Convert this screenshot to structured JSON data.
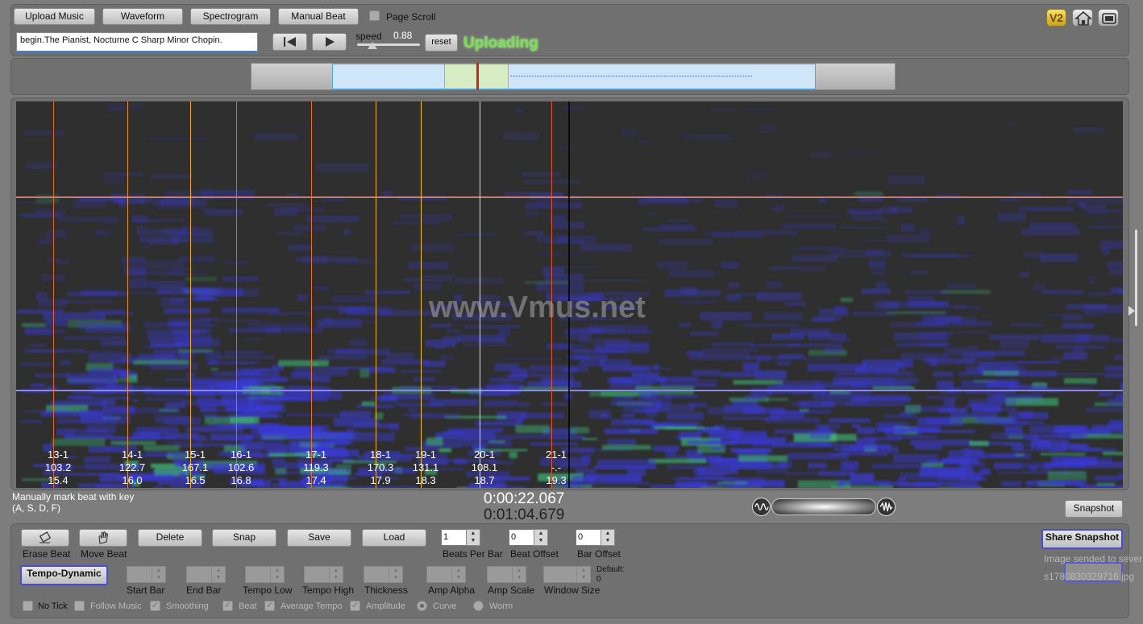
{
  "toolbar": {
    "upload_label": "Upload Music",
    "waveform_label": "Waveform",
    "spectrogram_label": "Spectrogram",
    "manual_beat_label": "Manual Beat",
    "page_scroll_label": "Page Scroll",
    "track_name": "begin.The Pianist, Nocturne C Sharp Minor Chopin.",
    "speed_label": "speed",
    "speed_value": "0.88",
    "reset_label": "reset",
    "status": "Uploading"
  },
  "top_icons": {
    "version_label": "V2"
  },
  "spectrogram": {
    "watermark": "www.Vmus.net",
    "beats": [
      {
        "bar": "13-1",
        "tempo": "103.2",
        "time": "15.4",
        "color": "#e0662a"
      },
      {
        "bar": "14-1",
        "tempo": "122.7",
        "time": "16.0",
        "color": "#e8932a"
      },
      {
        "bar": "15-1",
        "tempo": "167.1",
        "time": "16.5",
        "color": "#f0b028"
      },
      {
        "bar": "16-1",
        "tempo": "102.6",
        "time": "16.8",
        "color": "#e0662a"
      },
      {
        "bar": "17-1",
        "tempo": "119.3",
        "time": "17.4",
        "color": "#e8702a"
      },
      {
        "bar": "18-1",
        "tempo": "170.3",
        "time": "17.9",
        "color": "#f0b028"
      },
      {
        "bar": "19-1",
        "tempo": "131.1",
        "time": "18.3",
        "color": "#f3c92a"
      },
      {
        "bar": "20-1",
        "tempo": "108.1",
        "time": "18.7",
        "color": "#f7e34a"
      },
      {
        "bar": "21-1",
        "tempo": "-.-",
        "time": "19.3",
        "color": "#e0562a"
      }
    ]
  },
  "status_row": {
    "hint_line1": "Manually mark beat with key",
    "hint_line2": "(A, S, D, F)",
    "current_time": "0:00:22.067",
    "total_time": "0:01:04.679",
    "snapshot_label": "Snapshot"
  },
  "controls": {
    "erase_beat": "Erase Beat",
    "move_beat": "Move Beat",
    "delete": "Delete",
    "snap": "Snap",
    "save": "Save",
    "load": "Load",
    "beats_per_bar_label": "Beats Per Bar",
    "beats_per_bar_value": "1",
    "beat_offset_label": "Beat Offset",
    "beat_offset_value": "0",
    "bar_offset_label": "Bar Offset",
    "bar_offset_value": "0",
    "share_snapshot": "Share Snapshot",
    "share_status": "Image sended to sever",
    "share_file": "s1780830329716.jpg",
    "tempo_dynamic": "Tempo-Dynamic",
    "start_bar": "Start Bar",
    "end_bar": "End Bar",
    "tempo_low": "Tempo Low",
    "tempo_high": "Tempo High",
    "thickness": "Thickness",
    "amp_alpha": "Amp Alpha",
    "amp_scale": "Amp Scale",
    "window_size": "Window Size",
    "default_label": "Default:",
    "default_value": "0",
    "no_tick": "No Tick",
    "follow_music": "Follow Music",
    "smoothing": "Smoothing",
    "beat": "Beat",
    "average_tempo": "Average Tempo",
    "amplitude": "Amplitude",
    "curve": "Curve",
    "worm": "Worm"
  },
  "colors": {
    "accent_status": "#7ddc5a",
    "spectrogram_bg": "#2f2f2f",
    "spectro_blue": "#3a3adc",
    "spectro_green": "#3fc27a",
    "amplitude_line": "#c0807a"
  }
}
